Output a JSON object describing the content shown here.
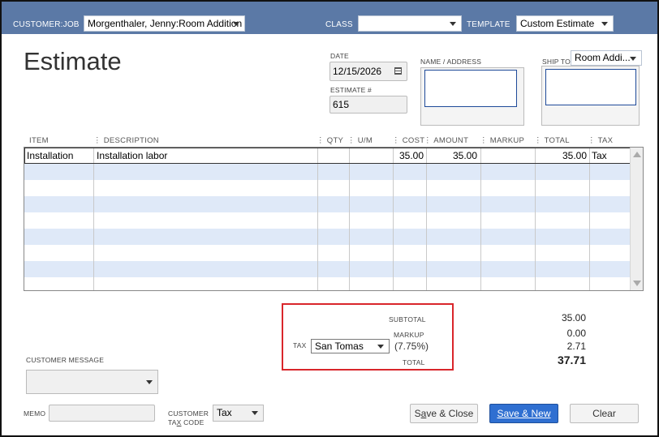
{
  "header": {
    "customer_job_label": "CUSTOMER:JOB",
    "customer_job_value": "Morgenthaler, Jenny:Room Addition",
    "class_label": "CLASS",
    "class_value": "",
    "template_label": "TEMPLATE",
    "template_value": "Custom Estimate"
  },
  "form": {
    "title": "Estimate",
    "date_label": "DATE",
    "date_value": "12/15/2026",
    "estimate_no_label": "ESTIMATE #",
    "estimate_no_value": "615",
    "name_address_label": "NAME / ADDRESS",
    "ship_to_label": "SHIP TO",
    "ship_to_value": "Room Addi..."
  },
  "table": {
    "columns": [
      "ITEM",
      "DESCRIPTION",
      "QTY",
      "U/M",
      "COST",
      "AMOUNT",
      "MARKUP",
      "TOTAL",
      "TAX"
    ],
    "rows": [
      {
        "item": "Installation",
        "description": "Installation labor",
        "qty": "",
        "um": "",
        "cost": "35.00",
        "amount": "35.00",
        "markup": "",
        "total": "35.00",
        "tax": "Tax"
      }
    ]
  },
  "totals": {
    "subtotal_label": "SUBTOTAL",
    "subtotal_value": "35.00",
    "markup_label": "MARKUP",
    "markup_value": "0.00",
    "tax_label": "TAX",
    "tax_item": "San Tomas",
    "tax_rate": "(7.75%)",
    "tax_value": "2.71",
    "total_label": "TOTAL",
    "total_value": "37.71"
  },
  "footer": {
    "customer_message_label": "CUSTOMER MESSAGE",
    "memo_label": "MEMO",
    "customer_tax_code_label_1": "CUSTOMER",
    "customer_tax_code_label_2a": "TA",
    "customer_tax_code_label_2b": "X",
    "customer_tax_code_label_2c": " CODE",
    "customer_tax_code_value": "Tax",
    "save_close_a": "S",
    "save_close_b": "a",
    "save_close_c": "ve & Close",
    "save_new_a": "S",
    "save_new_b": "ave & New",
    "clear_label": "Clear"
  },
  "colors": {
    "header_bar": "#5b79a6",
    "grid_stripe": "#dfe9f8",
    "highlight_box": "#d9262b",
    "primary_button": "#2f6fd1"
  }
}
